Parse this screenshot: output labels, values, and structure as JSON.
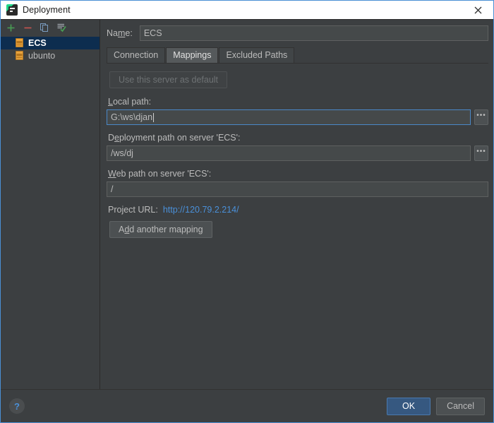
{
  "window": {
    "title": "Deployment",
    "icon": "pycharm-icon",
    "close_label": "×"
  },
  "sidebar": {
    "toolbar": [
      {
        "name": "add",
        "glyph": "+",
        "color": "#499c54"
      },
      {
        "name": "remove",
        "glyph": "−",
        "color": "#c75450"
      },
      {
        "name": "copy",
        "glyph": "copy-icon",
        "color": "#6a9fd4"
      },
      {
        "name": "set-default",
        "glyph": "default-server-icon",
        "color": "#499c54"
      }
    ],
    "servers": [
      {
        "label": "ECS",
        "selected": true
      },
      {
        "label": "ubunto",
        "selected": false
      }
    ]
  },
  "form": {
    "name_label": "Name:",
    "name_label_pre": "Na",
    "name_label_key": "m",
    "name_label_post": "e:",
    "name_value": "ECS",
    "tabs": [
      {
        "label": "Connection",
        "active": false
      },
      {
        "label": "Mappings",
        "active": true
      },
      {
        "label": "Excluded Paths",
        "active": false
      }
    ],
    "use_default_button": "Use this server as default",
    "local_path_label_pre": "",
    "local_path_label_key": "L",
    "local_path_label_post": "ocal path:",
    "local_path_value": "G:\\ws\\djan",
    "deployment_path_label_pre": "D",
    "deployment_path_label_key": "e",
    "deployment_path_label_post": "ployment path on server 'ECS':",
    "deployment_path_value": "/ws/dj",
    "web_path_label_pre": "",
    "web_path_label_key": "W",
    "web_path_label_post": "eb path on server 'ECS':",
    "web_path_value": "/",
    "project_url_label": "Project URL:",
    "project_url_value": "http://120.79.2.214/",
    "add_mapping_pre": "A",
    "add_mapping_key": "d",
    "add_mapping_post": "d another mapping",
    "browse_glyph": "•••"
  },
  "footer": {
    "help_label": "?",
    "ok_label": "OK",
    "cancel_label": "Cancel"
  },
  "colors": {
    "background": "#3c3f41",
    "field": "#45494a",
    "accent_blue": "#4a90d9",
    "ok_button": "#365880",
    "selection": "#0d2d4f",
    "add_green": "#499c54",
    "remove_red": "#c75450"
  }
}
